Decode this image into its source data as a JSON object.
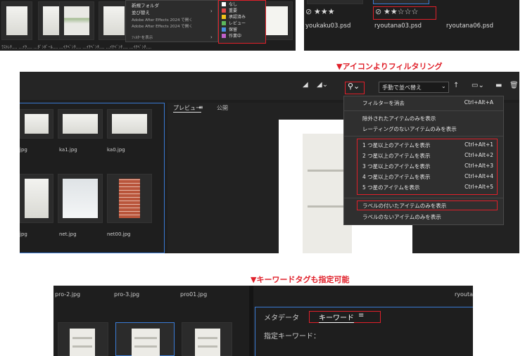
{
  "top_left": {
    "bottom_labels": "ﾗｽﾄﾚﾁ.... ...ｲｸ.... ...ﾀﾞﾝﾎﾞｰﾙ.... ...ｲﾅﾍﾞﾝﾁ.... ...ｲﾅﾍﾞﾝﾁ.... ...ｲﾅﾍﾞﾝﾁ.... ...ｲﾅﾍﾞﾝﾁ...."
  },
  "context_menu": {
    "items": [
      {
        "label": "新規フォルダ"
      },
      {
        "label": "並び替え"
      },
      {
        "label": "Adobe After Effects 2024 で開く"
      },
      {
        "label": "Adobe After Effects 2024 で開く"
      },
      {
        "label": "ﾌｨﾙﾀｰを表示"
      }
    ],
    "labels_submenu": [
      {
        "label": "なし",
        "color": "#ffffff"
      },
      {
        "label": "重要",
        "color": "#e24a4a"
      },
      {
        "label": "承認済み",
        "color": "#f0c419"
      },
      {
        "label": "レビュー",
        "color": "#5cb85c"
      },
      {
        "label": "保留",
        "color": "#4a90e2"
      },
      {
        "label": "作業中",
        "color": "#c061cb"
      }
    ]
  },
  "top_right": {
    "files": [
      {
        "name": "youkaku03.psd",
        "rating": "★★★"
      },
      {
        "name": "ryoutana03.psd",
        "rating": "★★☆☆☆"
      },
      {
        "name": "ryoutana06.psd",
        "rating": ""
      }
    ],
    "reject_icon": "⊘"
  },
  "caption1": "▼アイコンよりフィルタリング",
  "caption2": "▼キーワードタグも指定可能",
  "middle": {
    "sort_label": "手動で並べ替え",
    "preview_tab": "プレビュー",
    "preview_tab2": "公開",
    "files_row1": [
      "jpg",
      "ka1.jpg",
      "ka0.jpg"
    ],
    "files_row2": [
      "jpg",
      "net.jpg",
      "net00.jpg"
    ],
    "filter_menu": {
      "clear": {
        "label": "フィルターを消去",
        "shortcut": "Ctrl+Alt+A"
      },
      "show_reject": {
        "label": "除外されたアイテムのみを表示"
      },
      "show_unrated": {
        "label": "レーティングのないアイテムのみを表示"
      },
      "ratings": [
        {
          "label": "1 つ星以上のアイテムを表示",
          "shortcut": "Ctrl+Alt+1"
        },
        {
          "label": "2 つ星以上のアイテムを表示",
          "shortcut": "Ctrl+Alt+2"
        },
        {
          "label": "3 つ星以上のアイテムを表示",
          "shortcut": "Ctrl+Alt+3"
        },
        {
          "label": "4 つ星以上のアイテムを表示",
          "shortcut": "Ctrl+Alt+4"
        },
        {
          "label": "5 つ星のアイテムを表示",
          "shortcut": "Ctrl+Alt+5"
        }
      ],
      "labeled": {
        "label": "ラベルの付いたアイテムのみを表示"
      },
      "unlabeled": {
        "label": "ラベルのないアイテムのみを表示"
      }
    }
  },
  "bottom": {
    "files": [
      "pro-2.jpg",
      "pro-3.jpg",
      "pro01.jpg"
    ],
    "right_title": "ryouta",
    "tab_metadata": "メタデータ",
    "tab_keywords": "キーワード",
    "assigned_keywords": "指定キーワード："
  },
  "colors": {
    "accent_red": "#e0202a",
    "selection_blue": "#3a7bd5",
    "panel_bg": "#1e1e1e"
  }
}
